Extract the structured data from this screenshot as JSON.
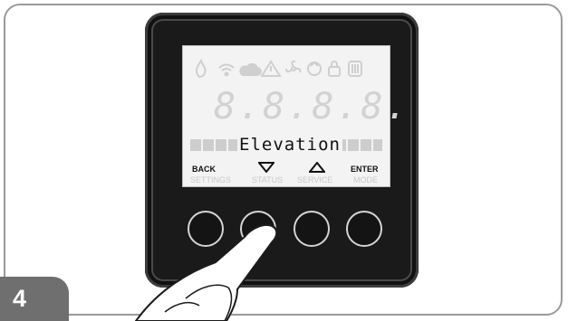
{
  "step": {
    "number": "4"
  },
  "lcd": {
    "digits": "8.8.8.8.",
    "message": "Elevation",
    "labels": {
      "back": "BACK",
      "settings": "SETTINGS",
      "status": "STATUS",
      "service": "SERVICE",
      "enter": "ENTER",
      "mode": "MODE"
    },
    "icons": [
      "flame-icon",
      "wifi-icon",
      "cloud-icon",
      "warning-icon",
      "fan-icon",
      "recycle-icon",
      "lock-icon",
      "heater-icon"
    ]
  },
  "colors": {
    "bezel": "#1a1a1a",
    "lcd_background": "#f3f3f3",
    "badge": "#6f6f6f"
  }
}
